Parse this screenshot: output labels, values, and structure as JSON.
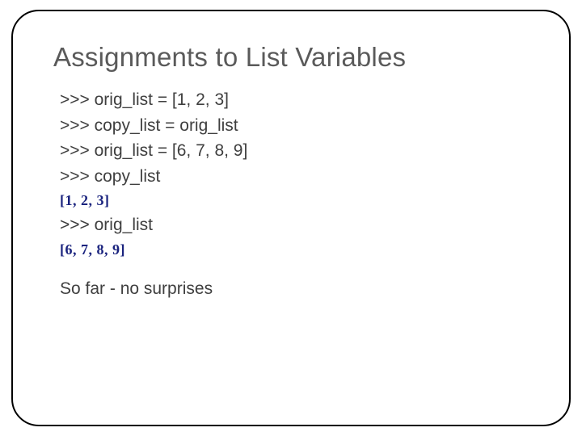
{
  "title": "Assignments to List Variables",
  "lines": {
    "l1": ">>> orig_list = [1, 2, 3]",
    "l2": ">>> copy_list = orig_list",
    "l3": ">>> orig_list = [6, 7, 8, 9]",
    "l4": ">>> copy_list",
    "out1": "[1, 2, 3]",
    "l5": ">>> orig_list",
    "out2": "[6, 7, 8, 9]"
  },
  "footer": "So far - no surprises"
}
